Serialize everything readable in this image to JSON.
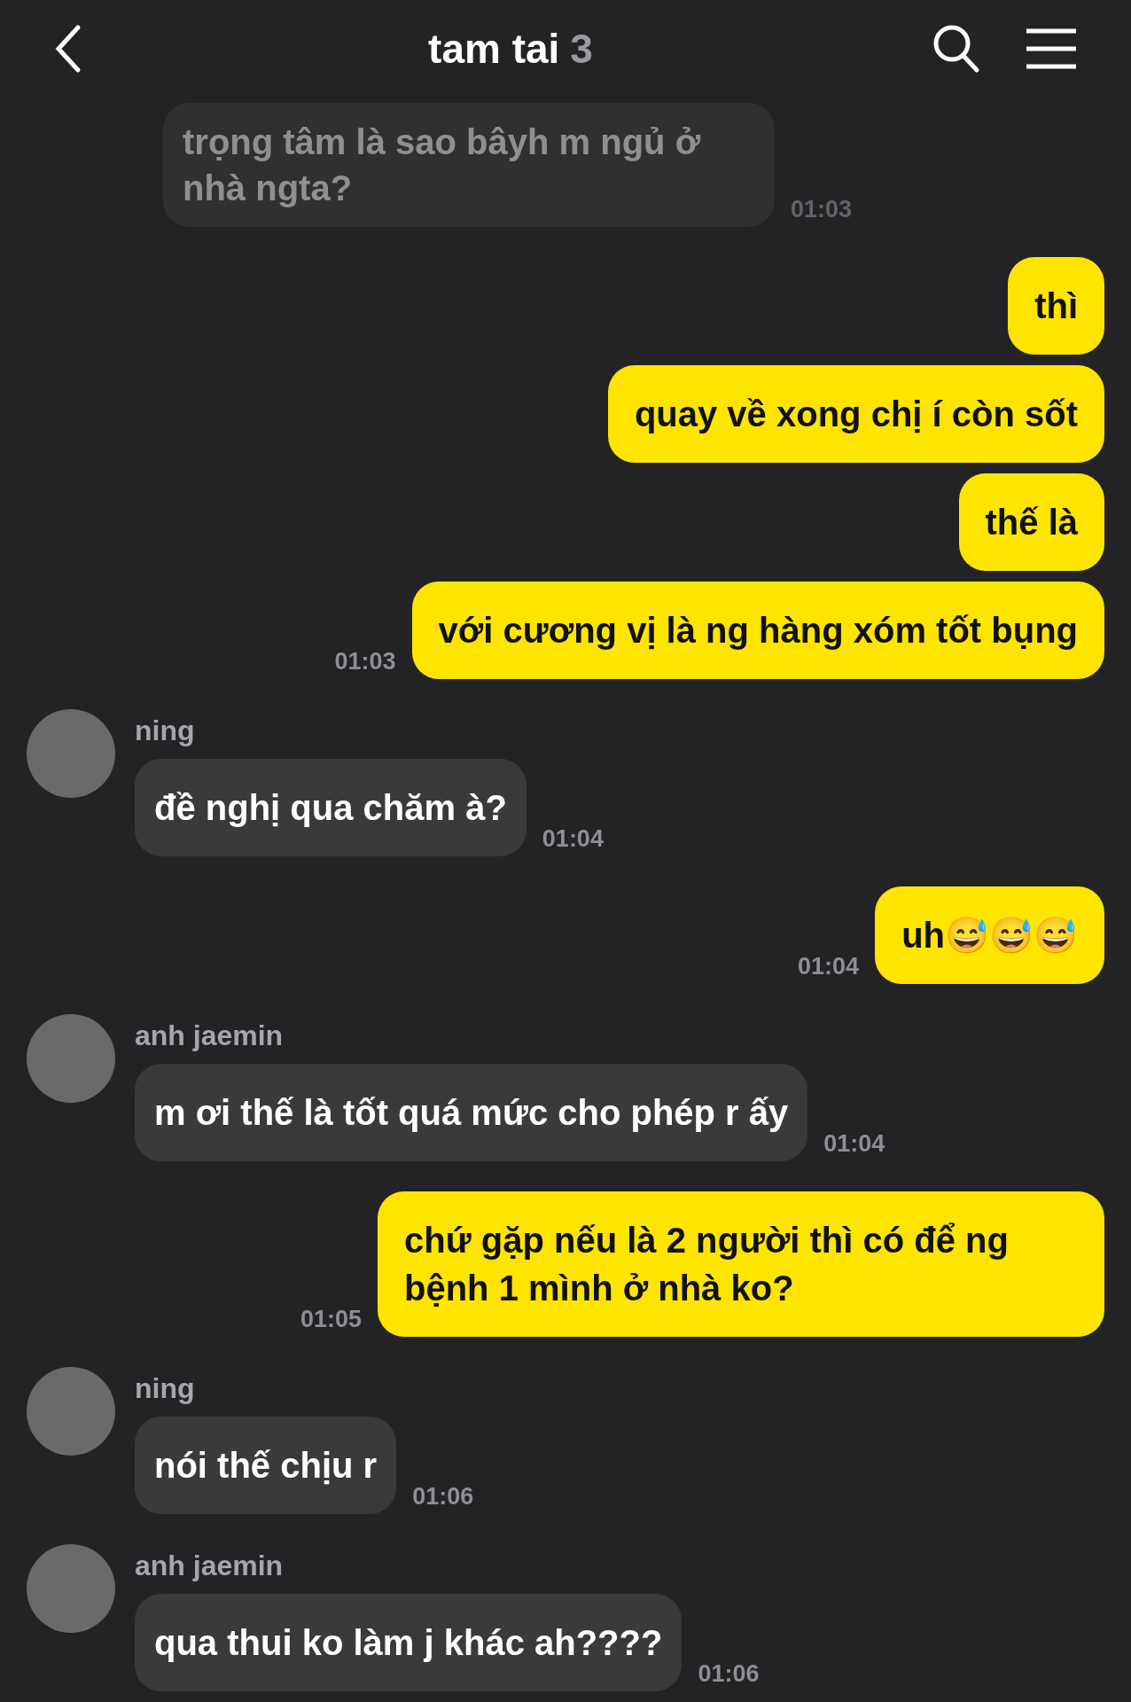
{
  "header": {
    "title": "tam tai",
    "member_count": "3"
  },
  "messages": [
    {
      "kind": "other",
      "faded": true,
      "text": "trọng tâm là sao bâyh m ngủ ở nhà ngta?",
      "time": "01:03"
    },
    {
      "kind": "mine",
      "lines": [
        "thì",
        "quay về xong chị í còn sốt",
        "thế là",
        "với cương vị là ng hàng xóm tốt bụng"
      ],
      "time": "01:03"
    },
    {
      "kind": "other",
      "sender": "ning",
      "text": "đề nghị qua chăm à?",
      "time": "01:04"
    },
    {
      "kind": "mine",
      "lines": [
        "uh😅😅😅"
      ],
      "time": "01:04"
    },
    {
      "kind": "other",
      "sender": "anh jaemin",
      "text": "m ơi thế là tốt quá mức cho phép r ấy",
      "time": "01:04"
    },
    {
      "kind": "mine",
      "lines": [
        "chứ gặp nếu là 2 người thì có để ng bệnh 1 mình ở nhà ko?"
      ],
      "time": "01:05"
    },
    {
      "kind": "other",
      "sender": "ning",
      "text": "nói thế chịu r",
      "time": "01:06"
    },
    {
      "kind": "other",
      "sender": "anh jaemin",
      "text": "qua thui ko làm j khác ah????",
      "time": "01:06"
    }
  ]
}
